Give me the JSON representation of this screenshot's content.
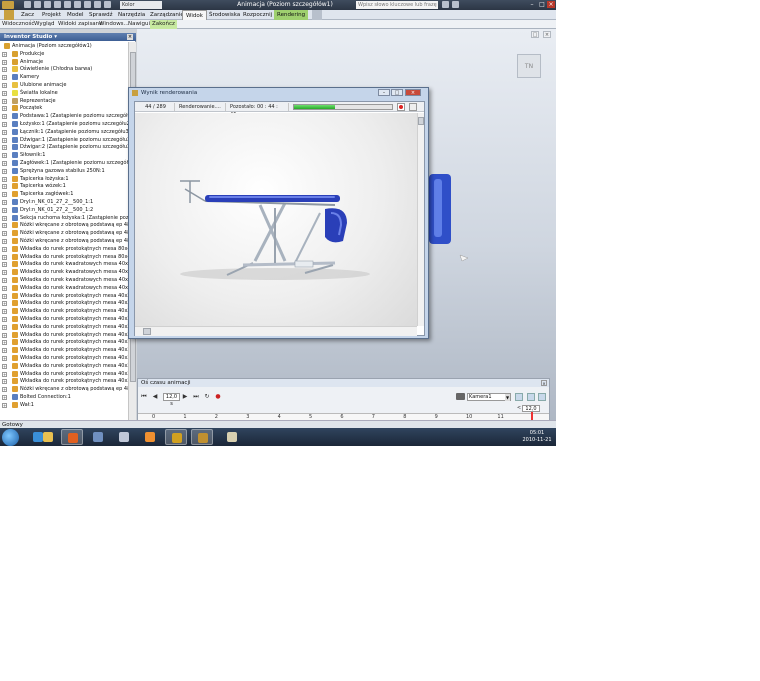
{
  "window": {
    "title": "Animacja (Poziom szczegółów1)",
    "doc_selector": "Kolor",
    "help_search_placeholder": "Wpisz słowo kluczowe lub frazę",
    "win_min": "–",
    "win_max": "□",
    "win_close": "×"
  },
  "menu": {
    "items": [
      "Zacz",
      "Projekt",
      "Model",
      "Sprawdź",
      "Narzędzia",
      "Zarządzanie",
      "Widok",
      "Środowiska",
      "Rozpocznij",
      "Rendering"
    ],
    "active": "Widok"
  },
  "ribbon": {
    "items": [
      "Widoczność",
      "Wygląd",
      "Widoki zapisane",
      "Windows...",
      "Nawigui",
      "Zakończ"
    ]
  },
  "browser": {
    "title": "Inventor Studio ▾",
    "close": "×",
    "tree": [
      {
        "label": "Animacja (Poziom szczegółów1)",
        "color": "#d8a030",
        "root": true
      },
      {
        "label": "Produkcje",
        "color": "#d8a030"
      },
      {
        "label": "Animacje",
        "color": "#d8a030"
      },
      {
        "label": "Oświetlenie (Chłodna barwa)",
        "color": "#e8c040"
      },
      {
        "label": "Kamery",
        "color": "#5a7fc0"
      },
      {
        "label": "Ulubione animacje",
        "color": "#e8c040"
      },
      {
        "label": "Światła lokalne",
        "color": "#e8e040"
      },
      {
        "label": "Reprezentacje",
        "color": "#c0a060"
      },
      {
        "label": "Początek",
        "color": "#d8a030"
      },
      {
        "label": "Podstawa:1 (Zastąpienie poziomu szczegółu2)",
        "color": "#5a7fc0"
      },
      {
        "label": "Łożysko:1 (Zastąpienie poziomu szczegółu2)",
        "color": "#5a7fc0"
      },
      {
        "label": "Łącznik:1 (Zastąpienie poziomu szczegółu3)",
        "color": "#5a7fc0"
      },
      {
        "label": "Dźwigar:1 (Zastąpienie poziomu szczegółu3)",
        "color": "#5a7fc0"
      },
      {
        "label": "Dźwigar:2 (Zastąpienie poziomu szczegółu3)",
        "color": "#5a7fc0"
      },
      {
        "label": "Siłownik:1",
        "color": "#5a7fc0"
      },
      {
        "label": "Zagłówek:1 (Zastąpienie poziomu szczegółu2)",
        "color": "#5a7fc0"
      },
      {
        "label": "Sprężyna gazowa stabilus 250N:1",
        "color": "#5a7fc0"
      },
      {
        "label": "Tapicerka łożyska:1",
        "color": "#e0a030"
      },
      {
        "label": "Tapicerka wózek:1",
        "color": "#e0a030"
      },
      {
        "label": "Tapicerka zagłówek:1",
        "color": "#e0a030"
      },
      {
        "label": "Dryl:n_NK_01_27_2__500_1:1",
        "color": "#5a7fc0"
      },
      {
        "label": "Dryl:n_NK_01_27_2__500_1:2",
        "color": "#5a7fc0"
      },
      {
        "label": "Sekcja ruchoma łożyska:1 (Zastąpienie poziomu szcz",
        "color": "#5a7fc0"
      },
      {
        "label": "Nóżki wkręcane z obrotową podstawą ep 48-40-469",
        "color": "#e0a030"
      },
      {
        "label": "Nóżki wkręcane z obrotową podstawą ep 48-40-469",
        "color": "#e0a030"
      },
      {
        "label": "Nóżki wkręcane z obrotową podstawą ep 48-40-469",
        "color": "#e0a030"
      },
      {
        "label": "Wkładka do rurek prostokątnych mesa 80x40:1",
        "color": "#e0a030"
      },
      {
        "label": "Wkładka do rurek prostokątnych mesa 80x40:2",
        "color": "#e0a030"
      },
      {
        "label": "Wkładka do rurek kwadratowych mesa 40x40:1",
        "color": "#e0a030"
      },
      {
        "label": "Wkładka do rurek kwadratowych mesa 40x40:2",
        "color": "#e0a030"
      },
      {
        "label": "Wkładka do rurek kwadratowych mesa 40x40:3",
        "color": "#e0a030"
      },
      {
        "label": "Wkładka do rurek kwadratowych mesa 40x40:4",
        "color": "#e0a030"
      },
      {
        "label": "Wkładka do rurek prostokątnych mesa 40x20:1",
        "color": "#e0a030"
      },
      {
        "label": "Wkładka do rurek prostokątnych mesa 40x20:2",
        "color": "#e0a030"
      },
      {
        "label": "Wkładka do rurek prostokątnych mesa 40x20:3",
        "color": "#e0a030"
      },
      {
        "label": "Wkładka do rurek prostokątnych mesa 40x20:4",
        "color": "#e0a030"
      },
      {
        "label": "Wkładka do rurek prostokątnych mesa 40x20:5",
        "color": "#e0a030"
      },
      {
        "label": "Wkładka do rurek prostokątnych mesa 40x20:6",
        "color": "#e0a030"
      },
      {
        "label": "Wkładka do rurek prostokątnych mesa 40x20:7",
        "color": "#e0a030"
      },
      {
        "label": "Wkładka do rurek prostokątnych mesa 40x20:8",
        "color": "#e0a030"
      },
      {
        "label": "Wkładka do rurek prostokątnych mesa 40x20:9",
        "color": "#e0a030"
      },
      {
        "label": "Wkładka do rurek prostokątnych mesa 40x20:10",
        "color": "#e0a030"
      },
      {
        "label": "Wkładka do rurek prostokątnych mesa 40x20:11",
        "color": "#e0a030"
      },
      {
        "label": "Wkładka do rurek prostokątnych mesa 40x20:12",
        "color": "#e0a030"
      },
      {
        "label": "Nóżki wkręcane z obrotową podstawą ep 48-40-469",
        "color": "#e0a030"
      },
      {
        "label": "Bolted Connection:1",
        "color": "#5a7fc0"
      },
      {
        "label": "Wał:1",
        "color": "#e0a030"
      }
    ]
  },
  "render_dialog": {
    "title": "Wynik renderowania",
    "frames": "44 / 289",
    "state": "Renderowanie....",
    "remaining": "Pozostało: 00 : 44 : 46",
    "progress_fraction": 0.42,
    "btn_min": "–",
    "btn_max": "□",
    "btn_close": "×"
  },
  "animation": {
    "panel_title": "Oś czasu animacji",
    "close": "×",
    "current_time": "12,0 s",
    "camera": "Kamera1",
    "end_time": "12,0",
    "ruler_labels": [
      "0",
      "1",
      "2",
      "3",
      "4",
      "5",
      "6",
      "7",
      "8",
      "9",
      "10",
      "11"
    ],
    "controls": {
      "to_start": "⏮",
      "prev": "◀",
      "play": "▶",
      "to_end": "⏭",
      "loop": "↻",
      "record": "●"
    }
  },
  "viewcube_label": "TN",
  "status": {
    "text": "Gotowy"
  },
  "taskbar": {
    "time": "05:01",
    "date": "2010-11-21",
    "apps": [
      {
        "name": "ie",
        "color": "#3a8fd8"
      },
      {
        "name": "explorer",
        "color": "#e8c050"
      },
      {
        "name": "firefox",
        "color": "#e06020"
      },
      {
        "name": "tools",
        "color": "#7090c0"
      },
      {
        "name": "notepad",
        "color": "#c0c8d8"
      },
      {
        "name": "media",
        "color": "#f09030"
      },
      {
        "name": "inventor",
        "color": "#d0a020"
      },
      {
        "name": "inventor-2",
        "color": "#c09030"
      },
      {
        "name": "calc",
        "color": "#d8d0b0"
      }
    ]
  }
}
